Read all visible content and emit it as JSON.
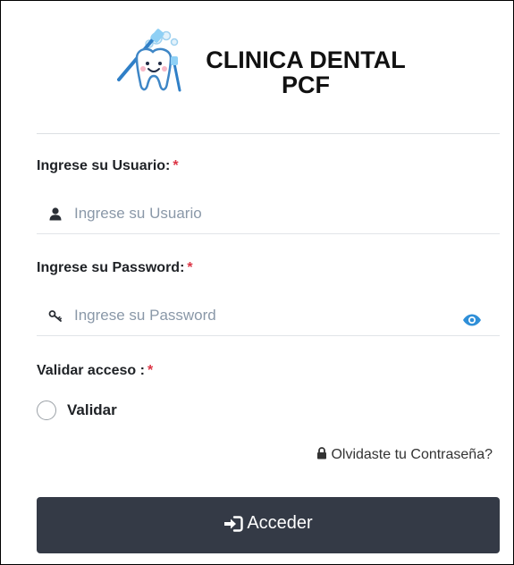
{
  "brand": {
    "line1": "CLINICA DENTAL",
    "line2": "PCF",
    "logo_icon": "tooth-mascot-icon"
  },
  "usuario": {
    "label": "Ingrese su Usuario:",
    "required_mark": "*",
    "placeholder": "Ingrese su Usuario",
    "value": "",
    "icon": "user-icon"
  },
  "password": {
    "label": "Ingrese su Password:",
    "required_mark": "*",
    "placeholder": "Ingrese su Password",
    "value": "",
    "icon": "key-icon",
    "toggle_icon": "eye-icon"
  },
  "validar": {
    "label": "Validar acceso :",
    "required_mark": "*",
    "option_label": "Validar",
    "checked": false
  },
  "forgot": {
    "text": "Olvidaste tu Contraseña?",
    "icon": "lock-icon"
  },
  "submit": {
    "label": "Acceder",
    "icon": "sign-in-icon"
  },
  "colors": {
    "button_bg": "#343a46",
    "required": "#dc3545",
    "accent": "#2f8fd8",
    "placeholder": "#8a98a8"
  }
}
